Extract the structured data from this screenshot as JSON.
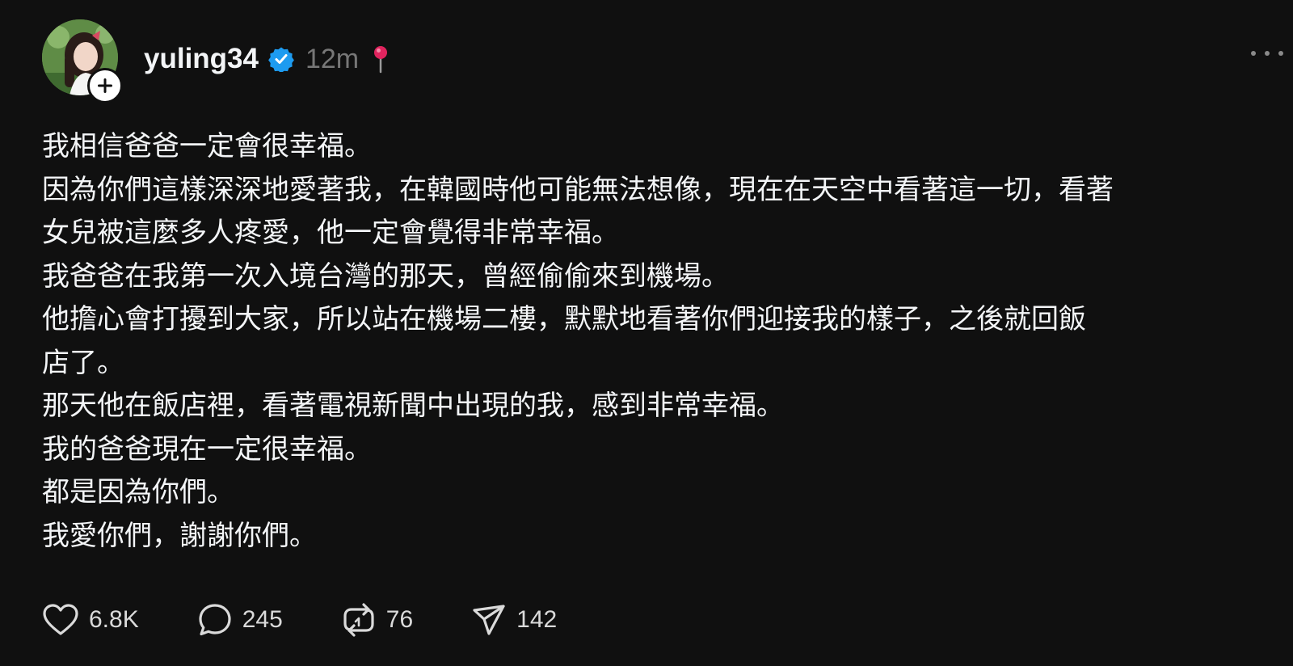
{
  "post": {
    "author": {
      "username": "yuling34",
      "verified": true
    },
    "timestamp": "12m",
    "icons": {
      "verified": "verified-badge-icon",
      "location": "pin-icon",
      "more": "more-horizontal-icon",
      "follow": "plus-icon"
    },
    "colors": {
      "background": "#101010",
      "text": "#f3f5f7",
      "muted": "#777777",
      "verified": "#1d9bf0",
      "pin": "#e0245e"
    },
    "lines": [
      "我相信爸爸一定會很幸福。",
      "因為你們這樣深深地愛著我，在韓國時他可能無法想像，現在在天空中看著這一切，看著",
      "女兒被這麼多人疼愛，他一定會覺得非常幸福。",
      "我爸爸在我第一次入境台灣的那天，曾經偷偷來到機場。",
      "他擔心會打擾到大家，所以站在機場二樓，默默地看著你們迎接我的樣子，之後就回飯",
      "店了。",
      "那天他在飯店裡，看著電視新聞中出現的我，感到非常幸福。",
      "我的爸爸現在一定很幸福。",
      "都是因為你們。",
      "我愛你們，謝謝你們。"
    ],
    "actions": {
      "likes": "6.8K",
      "replies": "245",
      "reposts": "76",
      "shares": "142"
    }
  }
}
